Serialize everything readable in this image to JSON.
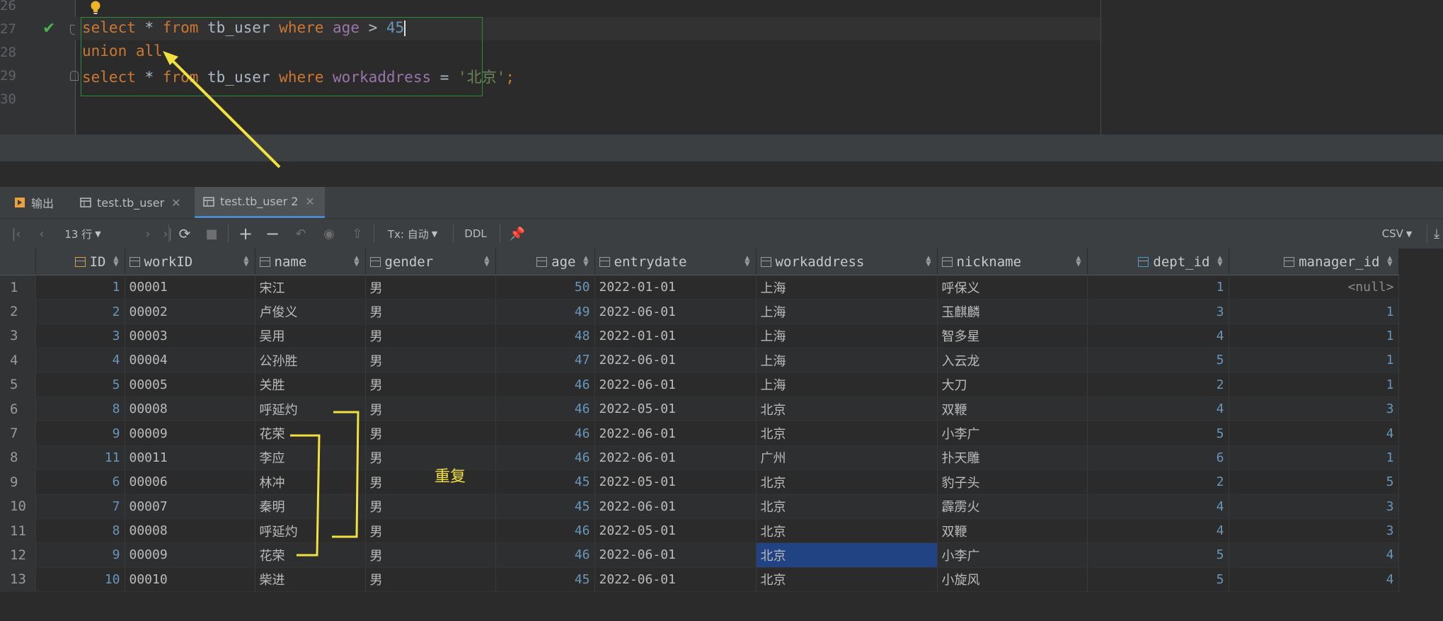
{
  "editor": {
    "line_numbers": [
      "26",
      "27",
      "28",
      "29",
      "30"
    ],
    "query_line1": {
      "k1": "select",
      "star": " * ",
      "k2": "from",
      "tbl": " tb_user ",
      "k3": "where",
      "col": " age",
      "op": " > ",
      "val": "45"
    },
    "query_line2": {
      "k1": "union all"
    },
    "query_line3": {
      "k1": "select",
      "star": " * ",
      "k2": "from",
      "tbl": " tb_user ",
      "k3": "where",
      "col": " workaddress",
      "op": " = ",
      "str": "'北京'",
      "semi": ";"
    }
  },
  "tabs": [
    {
      "label": "输出",
      "icon": "output-icon"
    },
    {
      "label": "test.tb_user",
      "icon": "table-icon"
    },
    {
      "label": "test.tb_user 2",
      "icon": "table-icon"
    }
  ],
  "toolbar": {
    "rows_label": "13 行",
    "tx_label": "Tx: 自动",
    "ddl_label": "DDL",
    "export_label": "CSV"
  },
  "table": {
    "columns": [
      "ID",
      "workID",
      "name",
      "gender",
      "age",
      "entrydate",
      "workaddress",
      "nickname",
      "dept_id",
      "manager_id"
    ],
    "rows": [
      [
        "1",
        "1",
        "00001",
        "宋江",
        "男",
        "50",
        "2022-01-01",
        "上海",
        "呼保义",
        "1",
        "<null>"
      ],
      [
        "2",
        "2",
        "00002",
        "卢俊义",
        "男",
        "49",
        "2022-06-01",
        "上海",
        "玉麒麟",
        "3",
        "1"
      ],
      [
        "3",
        "3",
        "00003",
        "吴用",
        "男",
        "48",
        "2022-01-01",
        "上海",
        "智多星",
        "4",
        "1"
      ],
      [
        "4",
        "4",
        "00004",
        "公孙胜",
        "男",
        "47",
        "2022-06-01",
        "上海",
        "入云龙",
        "5",
        "1"
      ],
      [
        "5",
        "5",
        "00005",
        "关胜",
        "男",
        "46",
        "2022-06-01",
        "上海",
        "大刀",
        "2",
        "1"
      ],
      [
        "6",
        "8",
        "00008",
        "呼延灼",
        "男",
        "46",
        "2022-05-01",
        "北京",
        "双鞭",
        "4",
        "3"
      ],
      [
        "7",
        "9",
        "00009",
        "花荣",
        "男",
        "46",
        "2022-06-01",
        "北京",
        "小李广",
        "5",
        "4"
      ],
      [
        "8",
        "11",
        "00011",
        "李应",
        "男",
        "46",
        "2022-06-01",
        "广州",
        "扑天雕",
        "6",
        "1"
      ],
      [
        "9",
        "6",
        "00006",
        "林冲",
        "男",
        "45",
        "2022-05-01",
        "北京",
        "豹子头",
        "2",
        "5"
      ],
      [
        "10",
        "7",
        "00007",
        "秦明",
        "男",
        "45",
        "2022-06-01",
        "北京",
        "霹雳火",
        "4",
        "3"
      ],
      [
        "11",
        "8",
        "00008",
        "呼延灼",
        "男",
        "46",
        "2022-05-01",
        "北京",
        "双鞭",
        "4",
        "3"
      ],
      [
        "12",
        "9",
        "00009",
        "花荣",
        "男",
        "46",
        "2022-06-01",
        "北京",
        "小李广",
        "5",
        "4"
      ],
      [
        "13",
        "10",
        "00010",
        "柴进",
        "男",
        "45",
        "2022-06-01",
        "北京",
        "小旋风",
        "5",
        "4"
      ]
    ],
    "selected_cell": {
      "row": 12,
      "column": "workaddress"
    }
  },
  "annotation": {
    "duplicate_label": "重复",
    "color": "#f0e040"
  },
  "colors": {
    "keyword": "#cc7832",
    "column": "#9876aa",
    "number": "#6897bb",
    "string": "#6a8759",
    "selection": "#214283"
  }
}
